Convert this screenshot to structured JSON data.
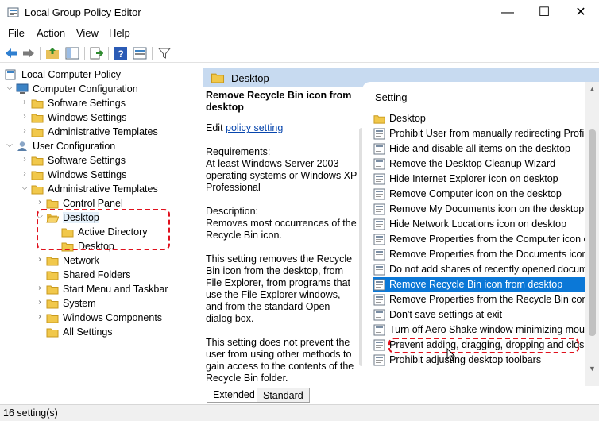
{
  "window": {
    "title": "Local Group Policy Editor",
    "controls": [
      "—",
      "☐",
      "✕"
    ]
  },
  "menu": [
    "File",
    "Action",
    "View",
    "Help"
  ],
  "tree": [
    {
      "label": "Local Computer Policy",
      "icon": "computer-policy-icon"
    },
    {
      "label": "Computer Configuration",
      "icon": "computer-icon"
    },
    {
      "label": "Software Settings",
      "icon": "folder-icon"
    },
    {
      "label": "Windows Settings",
      "icon": "folder-icon"
    },
    {
      "label": "Administrative Templates",
      "icon": "folder-icon"
    },
    {
      "label": "User Configuration",
      "icon": "user-icon"
    },
    {
      "label": "Software Settings",
      "icon": "folder-icon"
    },
    {
      "label": "Windows Settings",
      "icon": "folder-icon"
    },
    {
      "label": "Administrative Templates",
      "icon": "folder-icon"
    },
    {
      "label": "Control Panel",
      "icon": "folder-icon"
    },
    {
      "label": "Desktop",
      "icon": "folder-open-icon"
    },
    {
      "label": "Active Directory",
      "icon": "folder-icon"
    },
    {
      "label": "Desktop",
      "icon": "folder-icon"
    },
    {
      "label": "Network",
      "icon": "folder-icon"
    },
    {
      "label": "Shared Folders",
      "icon": "folder-icon"
    },
    {
      "label": "Start Menu and Taskbar",
      "icon": "folder-icon"
    },
    {
      "label": "System",
      "icon": "folder-icon"
    },
    {
      "label": "Windows Components",
      "icon": "folder-icon"
    },
    {
      "label": "All Settings",
      "icon": "folder-icon"
    }
  ],
  "right_header": "Desktop",
  "extended": {
    "title": "Remove Recycle Bin icon from desktop",
    "edit_prefix": "Edit ",
    "edit_link": "policy setting ",
    "req_label": "Requirements:",
    "req_text": "At least Windows Server 2003 operating systems or Windows XP Professional",
    "desc_label": "Description:",
    "desc_1": "Removes most occurrences of the Recycle Bin icon.",
    "desc_2": "This setting removes the Recycle Bin icon from the desktop, from File Explorer, from programs that use the File Explorer windows, and from the standard Open dialog box.",
    "desc_3": "This setting does not prevent the user from using other methods to gain access to the contents of the Recycle Bin folder."
  },
  "list": {
    "header": "Setting",
    "rows": [
      {
        "label": "Desktop",
        "icon": "folder-icon"
      },
      {
        "label": "Prohibit User from manually redirecting Profile",
        "icon": "policy-icon"
      },
      {
        "label": "Hide and disable all items on the desktop",
        "icon": "policy-icon"
      },
      {
        "label": "Remove the Desktop Cleanup Wizard",
        "icon": "policy-icon"
      },
      {
        "label": "Hide Internet Explorer icon on desktop",
        "icon": "policy-icon"
      },
      {
        "label": "Remove Computer icon on the desktop",
        "icon": "policy-icon"
      },
      {
        "label": "Remove My Documents icon on the desktop",
        "icon": "policy-icon"
      },
      {
        "label": "Hide Network Locations icon on desktop",
        "icon": "policy-icon"
      },
      {
        "label": "Remove Properties from the Computer icon co",
        "icon": "policy-icon"
      },
      {
        "label": "Remove Properties from the Documents icon c",
        "icon": "policy-icon"
      },
      {
        "label": "Do not add shares of recently opened docume",
        "icon": "policy-icon"
      },
      {
        "label": "Remove Recycle Bin icon from desktop",
        "icon": "policy-icon"
      },
      {
        "label": "Remove Properties from the Recycle Bin conte",
        "icon": "policy-icon"
      },
      {
        "label": "Don't save settings at exit",
        "icon": "policy-icon"
      },
      {
        "label": "Turn off Aero Shake window minimizing mous",
        "icon": "policy-icon"
      },
      {
        "label": "Prevent adding, dragging, dropping and closin",
        "icon": "policy-icon"
      },
      {
        "label": "Prohibit adjusting desktop toolbars",
        "icon": "policy-icon"
      }
    ]
  },
  "tabs": [
    "Extended",
    "Standard"
  ],
  "status": "16 setting(s)",
  "colors": {
    "accent": "#0b78d7",
    "header": "#c7daf0",
    "highlight": "#e0101c"
  }
}
